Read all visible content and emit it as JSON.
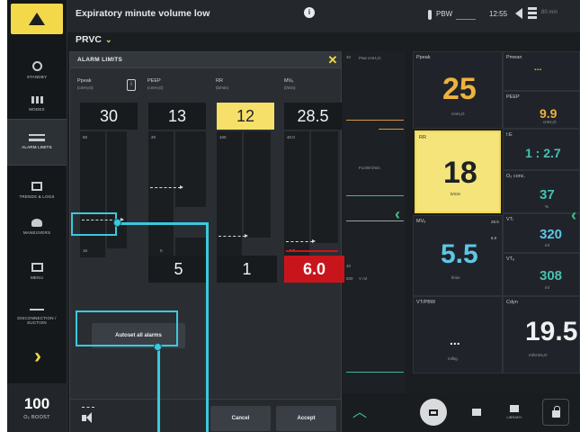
{
  "topbar": {
    "alarm_message": "Expiratory minute volume low",
    "info_symbol": "i",
    "pbw_label": "PBW",
    "time": "12:55",
    "battery_text": "80 min",
    "mode": "PRVC",
    "mode_chevron": "⌄"
  },
  "sidebar": {
    "items": [
      {
        "label": "STANDBY",
        "icon": "standby-icon"
      },
      {
        "label": "MODES",
        "icon": "modes-icon"
      },
      {
        "label": "ALARM LIMITS",
        "icon": "alarm-limits-icon"
      },
      {
        "label": "TRENDS & LOGS",
        "icon": "trends-icon"
      },
      {
        "label": "MANEUVERS",
        "icon": "maneuvers-icon"
      },
      {
        "label": "MENU",
        "icon": "menu-icon"
      },
      {
        "label": "DISCONNECTION / SUCTION",
        "icon": "suction-icon"
      }
    ],
    "more_chevron": "›",
    "o2_boost": {
      "value": "100",
      "label": "O₂ BOOST"
    }
  },
  "dialog": {
    "title": "ALARM LIMITS",
    "close_symbol": "✕",
    "info_symbol": "i",
    "columns": [
      {
        "name": "Ppeak",
        "unit": "(cmH₂O)",
        "high": "30",
        "low": "",
        "track_top": "50",
        "track_bottom": "16"
      },
      {
        "name": "PEEP",
        "unit": "(cmH₂O)",
        "high": "13",
        "low": "5",
        "track_top": "20",
        "track_bottom": "0"
      },
      {
        "name": "RR",
        "unit": "(b/min)",
        "high": "12",
        "low": "1",
        "track_top": "100",
        "track_bottom": ""
      },
      {
        "name": "MVₑ",
        "unit": "(l/min)",
        "high": "28.5",
        "low": "6.0",
        "track_top": "40.0",
        "track_bottom": "0.5"
      }
    ],
    "autoset_label": "Autoset all alarms",
    "cancel_label": "Cancel",
    "accept_label": "Accept"
  },
  "waveforms": {
    "pressure_label": "Paw cmH₂O",
    "flow_label": "FLOW l/min",
    "volume_label": "V ml",
    "scale_top": "40",
    "scale_mid": "40",
    "scale_bot": "500"
  },
  "params": {
    "ppeak": {
      "label": "Ppeak",
      "value": "25",
      "unit": "cmH₂O"
    },
    "pmean": {
      "label": "Pmean",
      "value": "...",
      "unit": ""
    },
    "peep": {
      "label": "PEEP",
      "value": "9.9",
      "unit": "cmH₂O"
    },
    "rr": {
      "label": "RR",
      "value": "18",
      "unit": "b/min"
    },
    "ie": {
      "label": "I:E",
      "value": "1 : 2.7",
      "unit": ""
    },
    "o2": {
      "label": "O₂ conc.",
      "value": "37",
      "unit": "%"
    },
    "mve": {
      "label": "MVₑ",
      "value": "5.5",
      "unit": "l/min",
      "hi": "28.5",
      "lo": "6.0"
    },
    "vti": {
      "label": "VTᵢ",
      "value": "320",
      "unit": "ml"
    },
    "vte": {
      "label": "VTₑ",
      "value": "308",
      "unit": "ml"
    },
    "vtpbw": {
      "label": "VT/PBW",
      "value": "...",
      "unit": "ml/kg"
    },
    "cdyn": {
      "label": "Cdyn",
      "value": "19.5",
      "unit": "ml/cmH₂O"
    }
  },
  "bottombar": {
    "up_chevron": "︿",
    "library_label": "LIBRARY"
  },
  "colors": {
    "accent_yellow": "#f3d84a",
    "alarm_red": "#c8151b",
    "callout_cyan": "#3cc8dd",
    "pressure_orange": "#eeb23c",
    "volume_blue": "#5ec7e6"
  }
}
